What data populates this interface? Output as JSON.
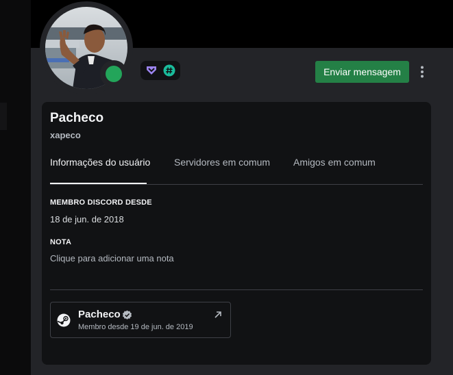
{
  "profile": {
    "display_name": "Pacheco",
    "username": "xapeco",
    "status": "online",
    "status_color": "#23a55a",
    "badges": [
      "hypesquad-icon",
      "hashtag-icon"
    ]
  },
  "actions": {
    "send_message_label": "Enviar mensagem",
    "more_icon": "vertical-ellipsis-icon",
    "accent_color": "#248046"
  },
  "tabs": [
    {
      "label": "Informações do usuário",
      "active": true
    },
    {
      "label": "Servidores em comum",
      "active": false
    },
    {
      "label": "Amigos em comum",
      "active": false
    }
  ],
  "member_since": {
    "title": "MEMBRO DISCORD DESDE",
    "value": "18 de jun. de 2018"
  },
  "note": {
    "title": "NOTA",
    "placeholder": "Clique para adicionar uma nota"
  },
  "connection": {
    "platform_icon": "steam-icon",
    "name": "Pacheco",
    "verified": true,
    "since": "Membro desde 19 de jun. de 2019",
    "link_icon": "external-link-icon"
  }
}
